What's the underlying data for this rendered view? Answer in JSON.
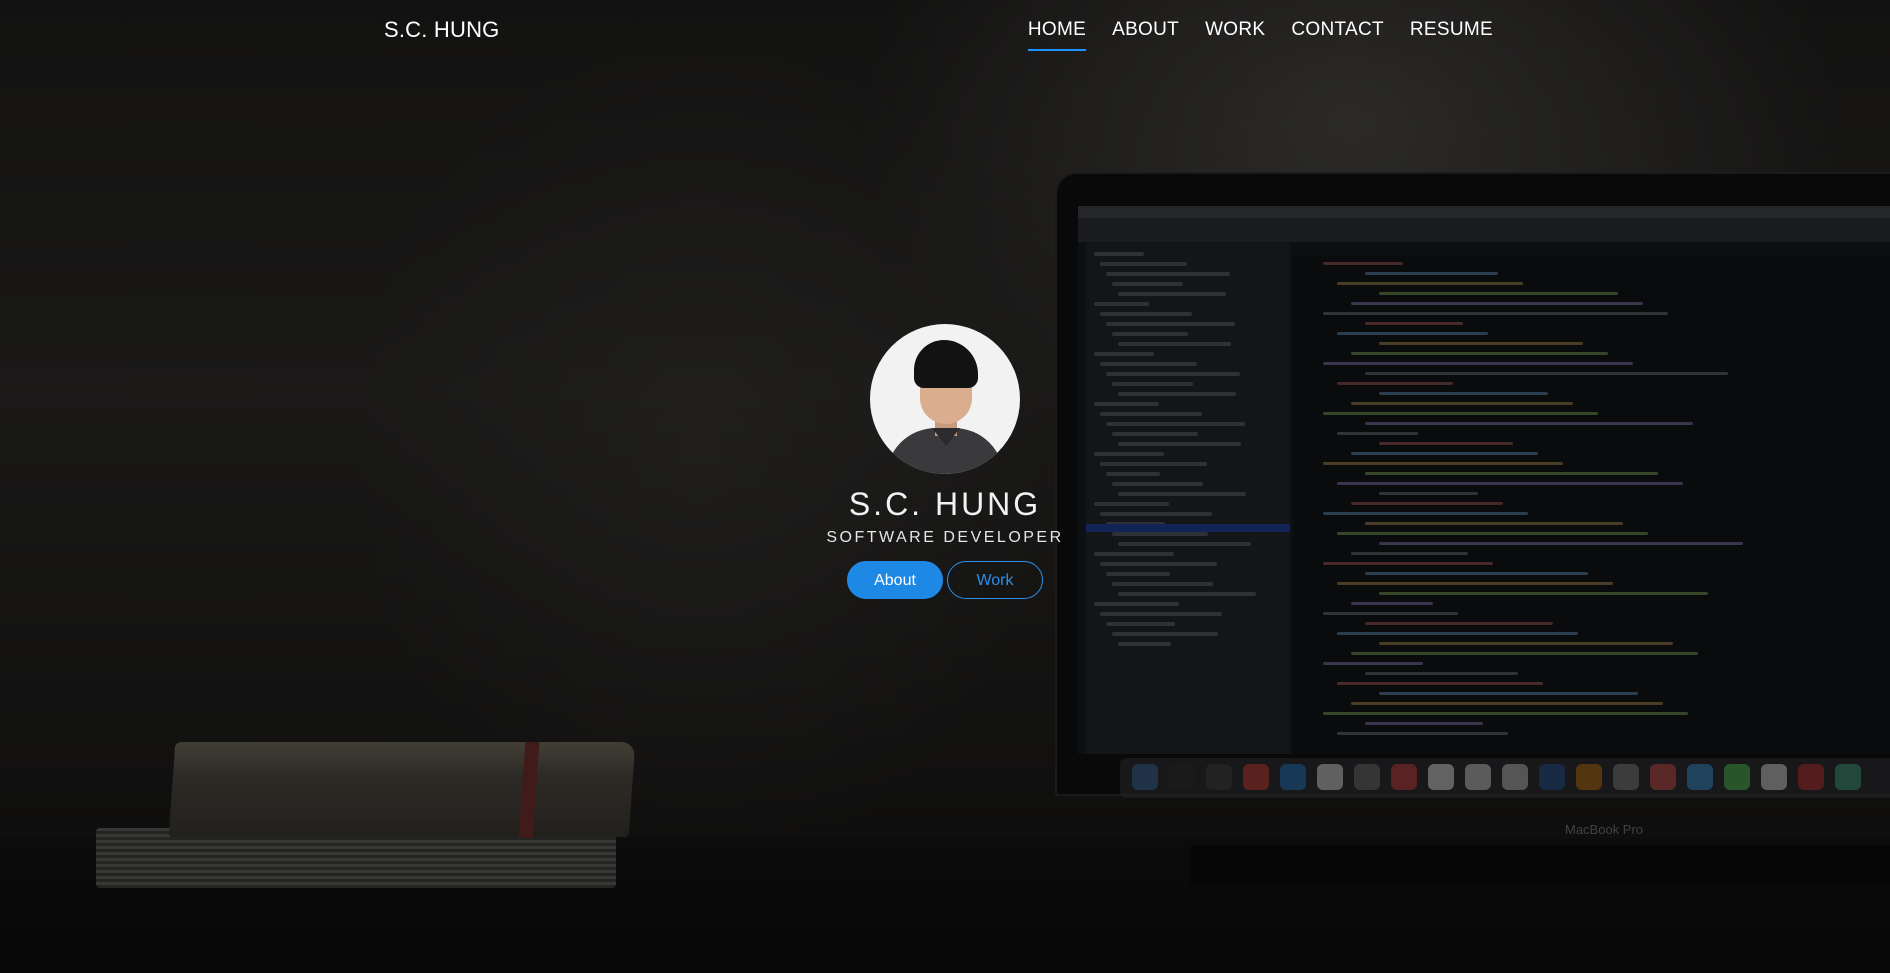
{
  "nav": {
    "brand": "S.C. HUNG",
    "items": [
      {
        "label": "HOME",
        "active": true
      },
      {
        "label": "ABOUT",
        "active": false
      },
      {
        "label": "WORK",
        "active": false
      },
      {
        "label": "CONTACT",
        "active": false
      },
      {
        "label": "RESUME",
        "active": false
      }
    ]
  },
  "hero": {
    "name": "S.C. HUNG",
    "subtitle": "SOFTWARE DEVELOPER",
    "buttons": {
      "about_label": "About",
      "work_label": "Work"
    },
    "laptop_label": "MacBook Pro"
  },
  "colors": {
    "accent": "#1e88e5",
    "nav_underline": "#1e90ff"
  }
}
